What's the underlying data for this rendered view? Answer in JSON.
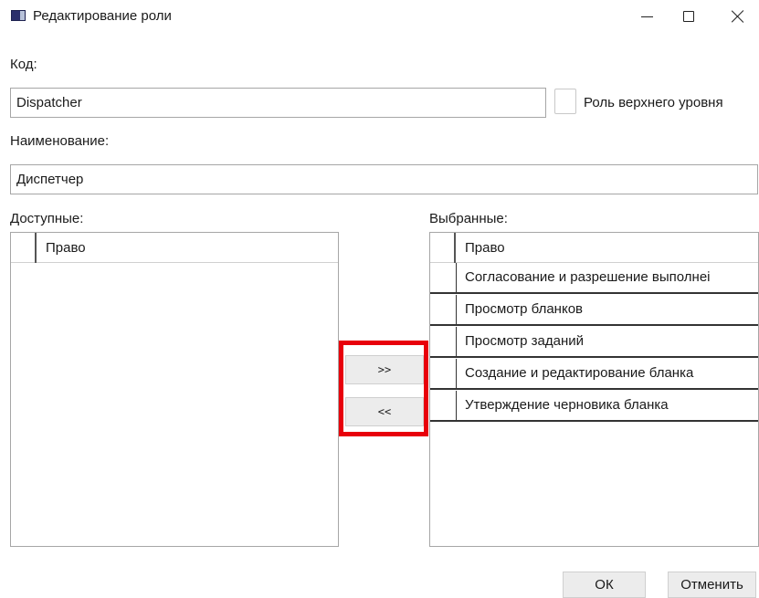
{
  "window": {
    "title": "Редактирование роли"
  },
  "form": {
    "code_label": "Код:",
    "code_value": "Dispatcher",
    "top_level_role_label": "Роль верхнего уровня",
    "top_level_role_checked": false,
    "name_label": "Наименование:",
    "name_value": "Диспетчер"
  },
  "available": {
    "label": "Доступные:",
    "column": "Право",
    "rows": []
  },
  "selected": {
    "label": "Выбранные:",
    "column": "Право",
    "rows": [
      "Согласование и разрешение выполнеі",
      "Просмотр бланков",
      "Просмотр заданий",
      "Создание и редактирование бланка",
      "Утверждение черновика бланка"
    ]
  },
  "transfer": {
    "add_label": ">>",
    "remove_label": "<<"
  },
  "footer": {
    "ok_label": "ОК",
    "cancel_label": "Отменить"
  },
  "colors": {
    "highlight": "#e8000b"
  }
}
